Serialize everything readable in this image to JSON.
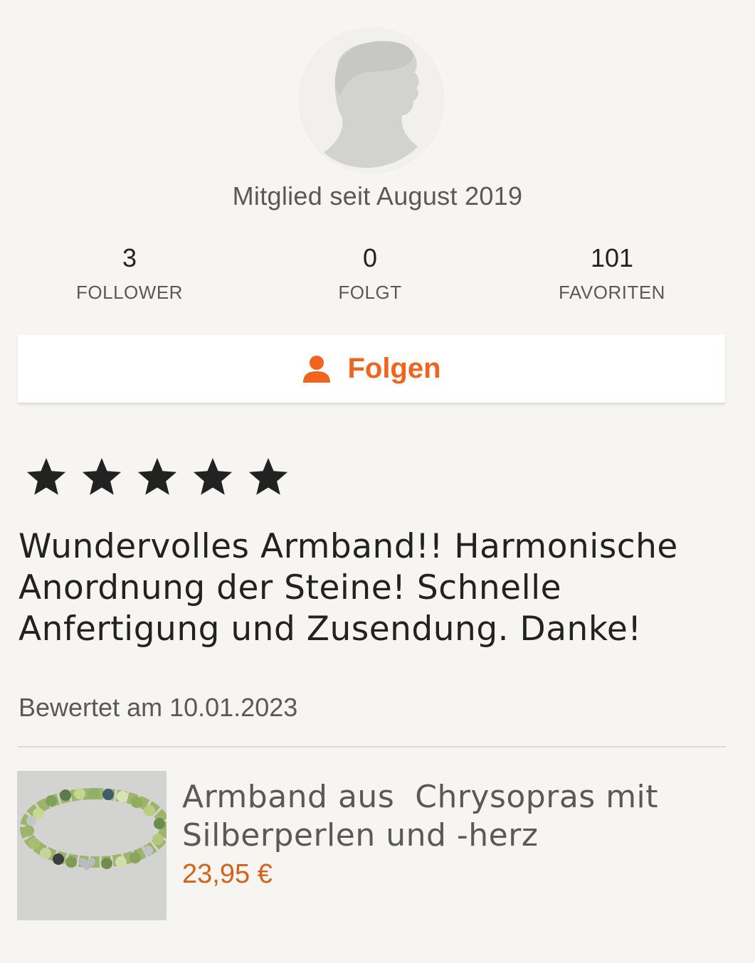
{
  "profile": {
    "avatar_icon": "default-user-silhouette-icon",
    "member_since": "Mitglied seit August 2019"
  },
  "stats": [
    {
      "value": "3",
      "label": "FOLLOWER"
    },
    {
      "value": "0",
      "label": "FOLGT"
    },
    {
      "value": "101",
      "label": "FAVORITEN"
    }
  ],
  "follow_button": {
    "icon": "user-icon",
    "label": "Folgen"
  },
  "review": {
    "rating": 5,
    "max_rating": 5,
    "text": "Wundervolles Armband!! Harmonische Anordnung der Steine! Schnelle Anfertigung und Zusendung. Danke!",
    "date": "Bewertet am 10.01.2023"
  },
  "product": {
    "title": "Armband aus  Chrysopras mit Silberperlen und -herz",
    "price": "23,95 €"
  },
  "colors": {
    "accent": "#f1641e",
    "price": "#d6621a",
    "background": "#f6f5f2"
  }
}
